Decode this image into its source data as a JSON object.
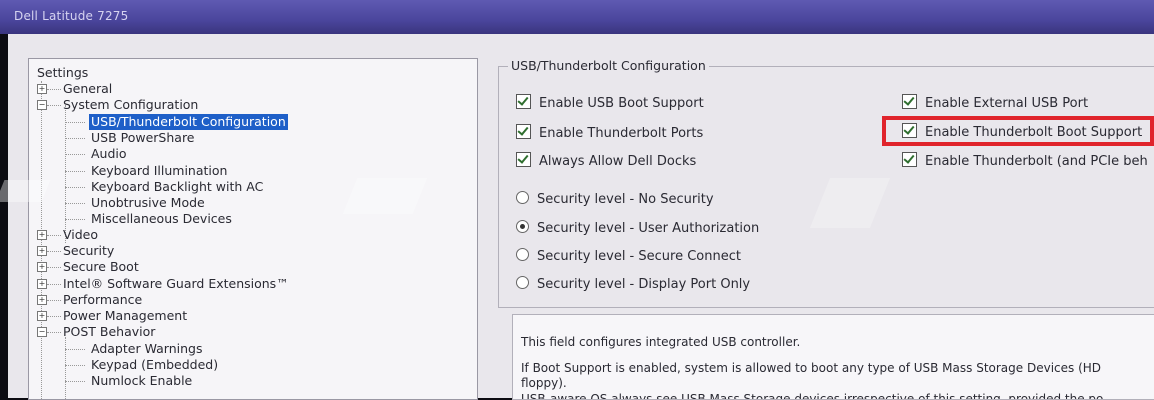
{
  "window": {
    "title": "Dell Latitude 7275"
  },
  "tree": {
    "root": "Settings",
    "items": [
      {
        "label": "General",
        "level": 1,
        "expander": "+"
      },
      {
        "label": "System Configuration",
        "level": 1,
        "expander": "−"
      },
      {
        "label": "USB/Thunderbolt Configuration",
        "level": 2,
        "selected": true
      },
      {
        "label": "USB PowerShare",
        "level": 2
      },
      {
        "label": "Audio",
        "level": 2
      },
      {
        "label": "Keyboard Illumination",
        "level": 2
      },
      {
        "label": "Keyboard Backlight with AC",
        "level": 2
      },
      {
        "label": "Unobtrusive Mode",
        "level": 2
      },
      {
        "label": "Miscellaneous Devices",
        "level": 2
      },
      {
        "label": "Video",
        "level": 1,
        "expander": "+"
      },
      {
        "label": "Security",
        "level": 1,
        "expander": "+"
      },
      {
        "label": "Secure Boot",
        "level": 1,
        "expander": "+"
      },
      {
        "label": "Intel® Software Guard Extensions™",
        "level": 1,
        "expander": "+"
      },
      {
        "label": "Performance",
        "level": 1,
        "expander": "+"
      },
      {
        "label": "Power Management",
        "level": 1,
        "expander": "+"
      },
      {
        "label": "POST Behavior",
        "level": 1,
        "expander": "−"
      },
      {
        "label": "Adapter Warnings",
        "level": 2
      },
      {
        "label": "Keypad (Embedded)",
        "level": 2
      },
      {
        "label": "Numlock Enable",
        "level": 2
      }
    ]
  },
  "group": {
    "title": "USB/Thunderbolt Configuration",
    "checkboxes_left": [
      {
        "label": "Enable USB Boot Support",
        "checked": true
      },
      {
        "label": "Enable Thunderbolt Ports",
        "checked": true
      },
      {
        "label": "Always Allow Dell Docks",
        "checked": true
      }
    ],
    "checkboxes_right": [
      {
        "label": "Enable External USB Port",
        "checked": true
      },
      {
        "label": "Enable Thunderbolt Boot Support",
        "checked": true
      },
      {
        "label": "Enable Thunderbolt (and PCIe beh",
        "checked": true
      }
    ],
    "radios": [
      {
        "label": "Security level - No Security",
        "selected": false
      },
      {
        "label": "Security level - User Authorization",
        "selected": true
      },
      {
        "label": "Security level - Secure Connect",
        "selected": false
      },
      {
        "label": "Security level - Display Port Only",
        "selected": false
      }
    ]
  },
  "description": {
    "line1": "This field configures integrated USB controller.",
    "line2": "If Boot Support is enabled, system is allowed to boot any type of USB Mass Storage Devices (HD",
    "line3": "floppy).",
    "line4": "USB-aware OS always see USB Mass Storage devices irrespective of this setting, provided the po"
  },
  "colors": {
    "title_bar": "#4a459c",
    "selection": "#1e5fc8",
    "highlight_box": "#e0242c"
  }
}
